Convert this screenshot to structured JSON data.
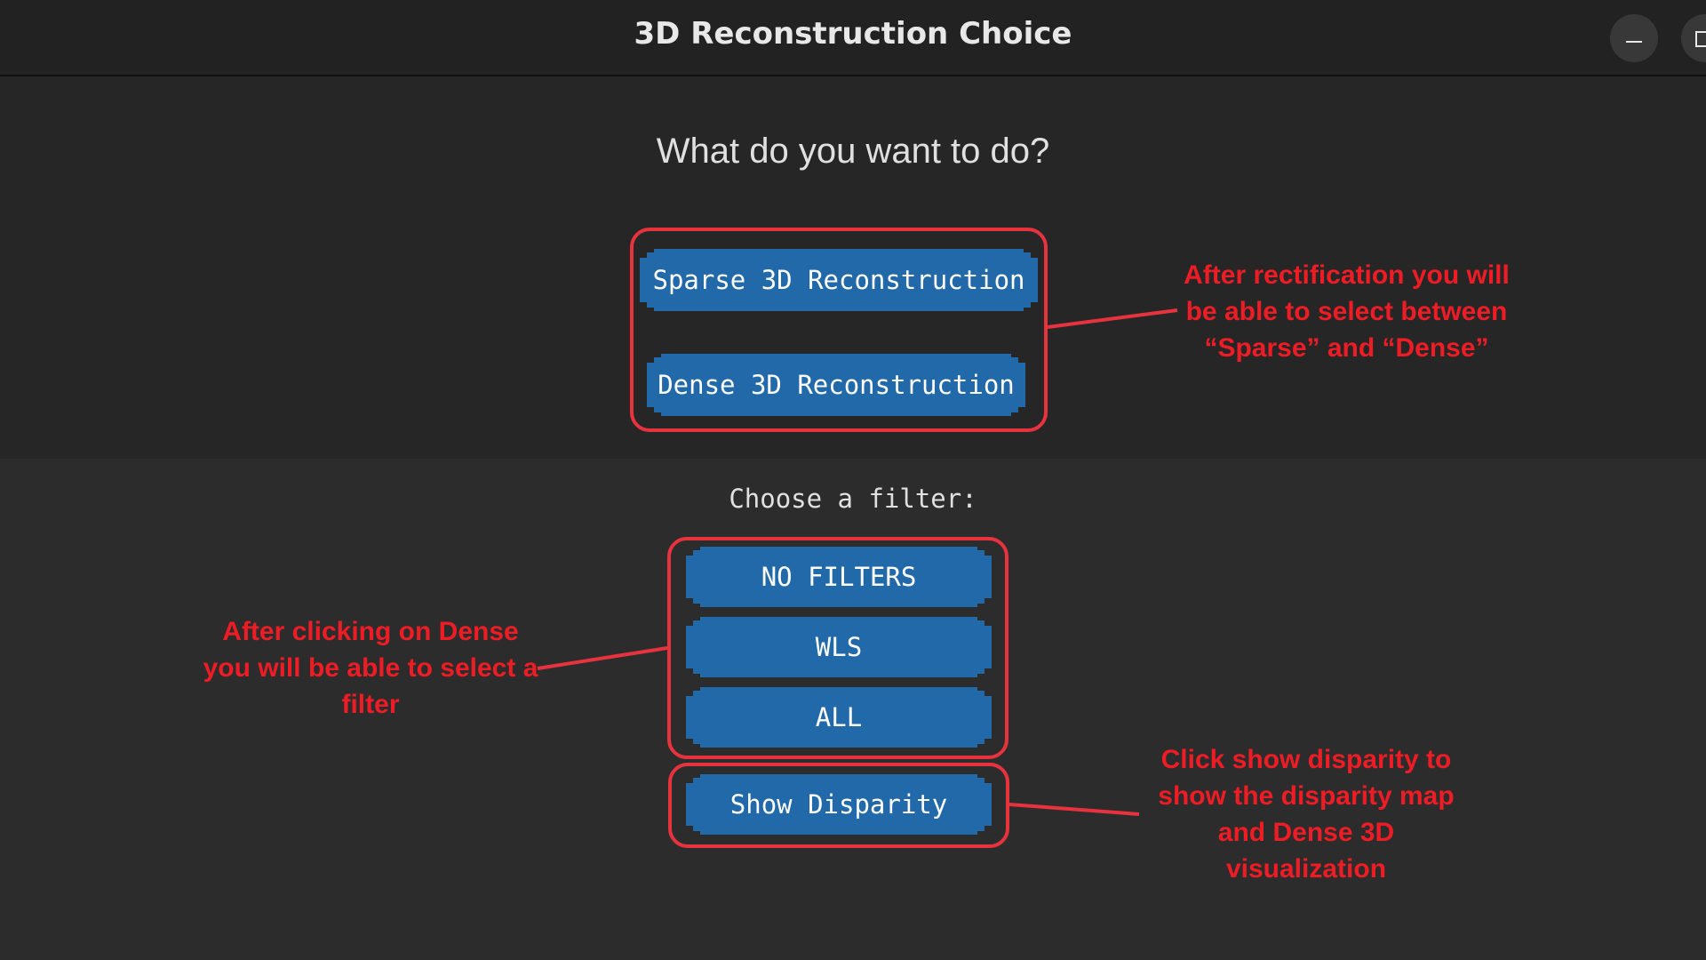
{
  "window": {
    "title": "3D Reconstruction Choice",
    "minimize_icon": "minimize-icon",
    "maximize_icon": "maximize-icon"
  },
  "reconstruction": {
    "question": "What do you want to do?",
    "sparse_label": "Sparse 3D Reconstruction",
    "dense_label": "Dense 3D Reconstruction"
  },
  "filters": {
    "label": "Choose a filter:",
    "options": [
      "NO FILTERS",
      "WLS",
      "ALL"
    ],
    "show_disparity_label": "Show Disparity"
  },
  "annotations": {
    "reconstruction_note": "After rectification you will be able to select between “Sparse” and “Dense”",
    "filter_note": "After clicking on Dense you will be able to select a filter",
    "disparity_note": "Click show disparity to show the disparity map and Dense 3D visualization"
  },
  "colors": {
    "button_blue": "#2169a8",
    "annotation_red": "#ee1c25",
    "highlight_red": "#e8333f",
    "background": "#262626"
  }
}
